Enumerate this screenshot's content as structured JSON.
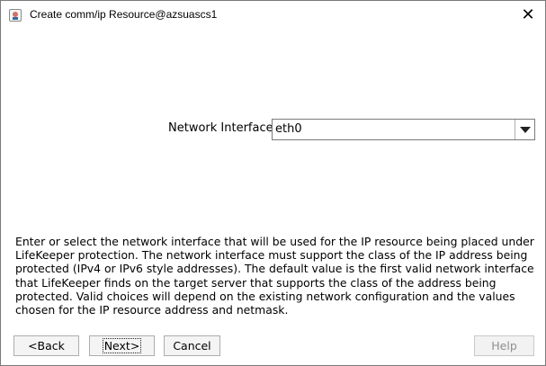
{
  "window": {
    "title": "Create comm/ip Resource@azsuascs1",
    "close_symbol": "✕",
    "icon": "java-app-icon"
  },
  "form": {
    "network_interface_label": "Network Interface",
    "network_interface_value": "eth0"
  },
  "description": "Enter or select the network interface that will be used for the IP resource being placed under LifeKeeper protection. The network interface must support the class of the IP address being protected (IPv4 or IPv6 style addresses). The default value is the first valid network interface that LifeKeeper finds on the target server that supports the class of the address being protected. Valid choices will depend on the existing network configuration and the values chosen for the IP resource address and netmask.",
  "buttons": {
    "back": "<Back",
    "next": "Next>",
    "cancel": "Cancel",
    "help": "Help"
  }
}
